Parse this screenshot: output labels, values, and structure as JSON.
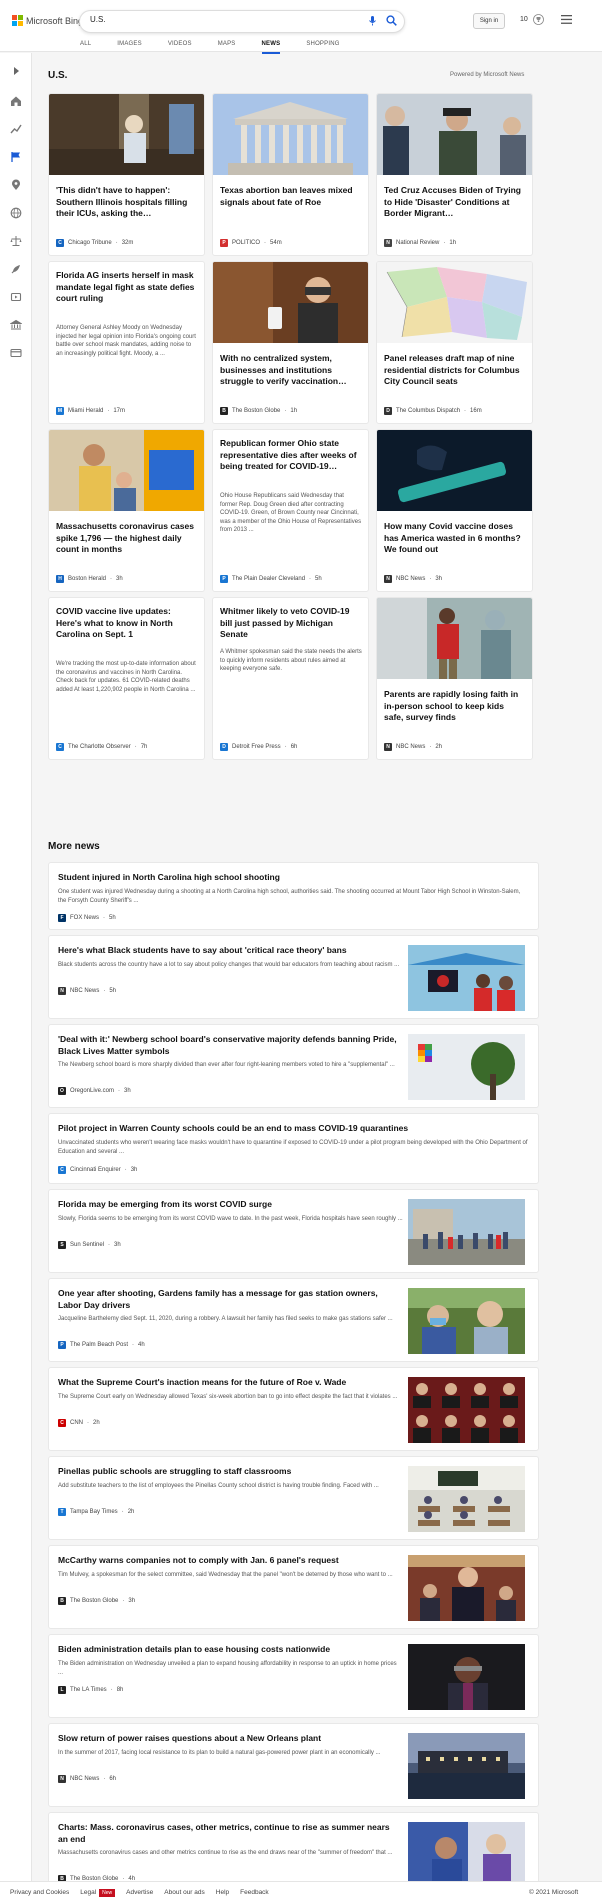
{
  "brand": {
    "name": "Microsoft Bing",
    "logo_colors": [
      "#f25022",
      "#7fba00",
      "#00a4ef",
      "#ffb900"
    ]
  },
  "search": {
    "value": "U.S."
  },
  "header": {
    "signin_label": "Sign in",
    "rewards_count": "10"
  },
  "nav": {
    "tabs": [
      "ALL",
      "IMAGES",
      "VIDEOS",
      "MAPS",
      "NEWS",
      "SHOPPING"
    ],
    "active": "NEWS"
  },
  "section": {
    "title": "U.S.",
    "powered_by": "Powered by Microsoft News"
  },
  "cards": [
    {
      "title": "'This didn't have to happen': Southern Illinois hospitals filling their ICUs, asking the…",
      "desc": "",
      "source": "Chicago Tribune",
      "time": "32m",
      "icon": "C",
      "icon_color": "#1565c0"
    },
    {
      "title": "Texas abortion ban leaves mixed signals about fate of Roe",
      "desc": "",
      "source": "POLITICO",
      "time": "54m",
      "icon": "P",
      "icon_color": "#d32f2f"
    },
    {
      "title": "Ted Cruz Accuses Biden of Trying to Hide 'Disaster' Conditions at Border Migrant…",
      "desc": "",
      "source": "National Review",
      "time": "1h",
      "icon": "N",
      "icon_color": "#444"
    },
    {
      "title": "Florida AG inserts herself in mask mandate legal fight as state defies court ruling",
      "desc": "Attorney General Ashley Moody on Wednesday injected her legal opinion into Florida's ongoing court battle over school mask mandates, adding noise to an increasingly political fight. Moody, a ...",
      "source": "Miami Herald",
      "time": "17m",
      "icon": "M",
      "icon_color": "#1976d2"
    },
    {
      "title": "With no centralized system, businesses and institutions struggle to verify vaccination…",
      "desc": "",
      "source": "The Boston Globe",
      "time": "1h",
      "icon": "B",
      "icon_color": "#222"
    },
    {
      "title": "Panel releases draft map of nine residential districts for Columbus City Council seats",
      "desc": "",
      "source": "The Columbus Dispatch",
      "time": "16m",
      "icon": "D",
      "icon_color": "#333"
    },
    {
      "title": "Massachusetts coronavirus cases spike 1,796 — the highest daily count in months",
      "desc": "",
      "source": "Boston Herald",
      "time": "3h",
      "icon": "H",
      "icon_color": "#1565c0"
    },
    {
      "title": "Republican former Ohio state representative dies after weeks of being treated for COVID-19…",
      "desc": "Ohio House Republicans said Wednesday that former Rep. Doug Green died after contracting COVID-19. Green, of Brown County near Cincinnati, was a member of the Ohio House of Representatives from 2013 ...",
      "source": "The Plain Dealer Cleveland",
      "time": "5h",
      "icon": "P",
      "icon_color": "#1976d2"
    },
    {
      "title": "How many Covid vaccine doses has America wasted in 6 months? We found out",
      "desc": "",
      "source": "NBC News",
      "time": "3h",
      "icon": "N",
      "icon_color": "#333"
    },
    {
      "title": "COVID vaccine live updates: Here's what to know in North Carolina on Sept. 1",
      "desc": "We're tracking the most up-to-date information about the coronavirus and vaccines in North Carolina. Check back for updates. 61 COVID-related deaths added At least 1,220,902 people in North Carolina ...",
      "source": "The Charlotte Observer",
      "time": "7h",
      "icon": "C",
      "icon_color": "#1976d2"
    },
    {
      "title": "Whitmer likely to veto COVID-19 bill just passed by Michigan Senate",
      "desc": "A Whitmer spokesman said the state needs the alerts to quickly inform residents about rules aimed at keeping everyone safe.",
      "source": "Detroit Free Press",
      "time": "6h",
      "icon": "D",
      "icon_color": "#1976d2"
    },
    {
      "title": "Parents are rapidly losing faith in in-person school to keep kids safe, survey finds",
      "desc": "",
      "source": "NBC News",
      "time": "2h",
      "icon": "N",
      "icon_color": "#333"
    }
  ],
  "more": {
    "title": "More news",
    "items": [
      {
        "title": "Student injured in North Carolina high school shooting",
        "desc": "One student was injured Wednesday during a shooting at a North Carolina high school, authorities said. The shooting occurred at Mount Tabor High School in Winston-Salem, the Forsyth County Sheriff's ...",
        "source": "FOX News",
        "time": "5h",
        "icon": "F",
        "icon_color": "#003366",
        "has_image": false
      },
      {
        "title": "Here's what Black students have to say about 'critical race theory' bans",
        "desc": "Black students across the country have a lot to say about policy changes that would bar educators from teaching about racism ...",
        "source": "NBC News",
        "time": "5h",
        "icon": "N",
        "icon_color": "#333",
        "has_image": true
      },
      {
        "title": "'Deal with it:' Newberg school board's conservative majority defends banning Pride, Black Lives Matter symbols",
        "desc": "The Newberg school board is more sharply divided than ever after four right-leaning members voted to hire a \"supplemental\" ...",
        "source": "OregonLive.com",
        "time": "3h",
        "icon": "O",
        "icon_color": "#222",
        "has_image": true
      },
      {
        "title": "Pilot project in Warren County schools could be an end to mass COVID-19 quarantines",
        "desc": "Unvaccinated students who weren't wearing face masks wouldn't have to quarantine if exposed to COVID-19 under a pilot program being developed with the Ohio Department of Education and several ...",
        "source": "Cincinnati Enquirer",
        "time": "3h",
        "icon": "C",
        "icon_color": "#1976d2",
        "has_image": false
      },
      {
        "title": "Florida may be emerging from its worst COVID surge",
        "desc": "Slowly, Florida seems to be emerging from its worst COVID wave to date. In the past week, Florida hospitals have seen roughly ...",
        "source": "Sun Sentinel",
        "time": "3h",
        "icon": "S",
        "icon_color": "#222",
        "has_image": true
      },
      {
        "title": "One year after shooting, Gardens family has a message for gas station owners, Labor Day drivers",
        "desc": "Jacqueline Barthelemy died Sept. 11, 2020, during a robbery. A lawsuit her family has filed seeks to make gas stations safer ...",
        "source": "The Palm Beach Post",
        "time": "4h",
        "icon": "P",
        "icon_color": "#1565c0",
        "has_image": true
      },
      {
        "title": "What the Supreme Court's inaction means for the future of Roe v. Wade",
        "desc": "The Supreme Court early on Wednesday allowed Texas' six-week abortion ban to go into effect despite the fact that it violates ...",
        "source": "CNN",
        "time": "2h",
        "icon": "C",
        "icon_color": "#cc0000",
        "has_image": true
      },
      {
        "title": "Pinellas public schools are struggling to staff classrooms",
        "desc": "Add substitute teachers to the list of employees the Pinellas County school district is having trouble finding. Faced with ...",
        "source": "Tampa Bay Times",
        "time": "2h",
        "icon": "T",
        "icon_color": "#1976d2",
        "has_image": true
      },
      {
        "title": "McCarthy warns companies not to comply with Jan. 6 panel's request",
        "desc": "Tim Mulvey, a spokesman for the select committee, said Wednesday that the panel \"won't be deterred by those who want to ...",
        "source": "The Boston Globe",
        "time": "3h",
        "icon": "B",
        "icon_color": "#222",
        "has_image": true
      },
      {
        "title": "Biden administration details plan to ease housing costs nationwide",
        "desc": "The Biden administration on Wednesday unveiled a plan to expand housing affordability in response to an uptick in home prices ...",
        "source": "The LA Times",
        "time": "8h",
        "icon": "L",
        "icon_color": "#222",
        "has_image": true
      },
      {
        "title": "Slow return of power raises questions about a New Orleans plant",
        "desc": "In the summer of 2017, facing local resistance to its plan to build a natural gas-powered power plant in an economically ...",
        "source": "NBC News",
        "time": "6h",
        "icon": "N",
        "icon_color": "#333",
        "has_image": true
      },
      {
        "title": "Charts: Mass. coronavirus cases, other metrics, continue to rise as summer nears an end",
        "desc": "Massachusetts coronavirus cases and other metrics continue to rise as the end draws near of the \"summer of freedom\" that ...",
        "source": "The Boston Globe",
        "time": "4h",
        "icon": "B",
        "icon_color": "#222",
        "has_image": true
      }
    ]
  },
  "footer": {
    "links": [
      "Privacy and Cookies",
      "Legal",
      "Advertise",
      "About our ads",
      "Help",
      "Feedback"
    ],
    "new_badge": "New",
    "copyright": "© 2021 Microsoft"
  },
  "colors": {
    "accent": "#1a5bd6",
    "background": "#f5f5f5"
  }
}
